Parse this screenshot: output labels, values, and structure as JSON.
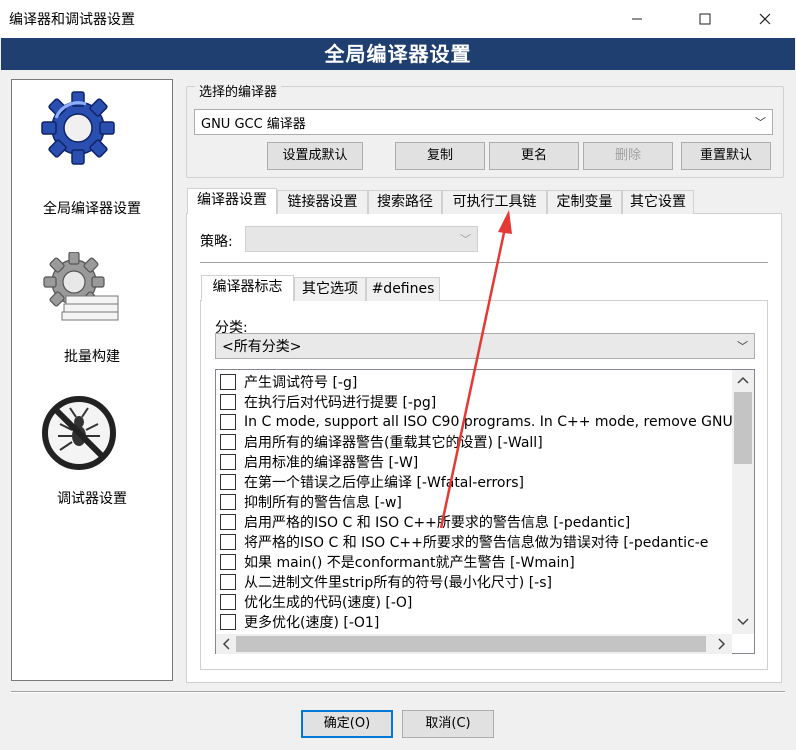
{
  "window": {
    "title": "编译器和调试器设置",
    "minimize": "—",
    "maximize": "☐",
    "close": "✕"
  },
  "banner": {
    "title": "全局编译器设置"
  },
  "sidebar": {
    "items": [
      {
        "label": "全局编译器设置",
        "icon": "gear-icon"
      },
      {
        "label": "批量构建",
        "icon": "batch-build-icon"
      },
      {
        "label": "调试器设置",
        "icon": "no-bug-icon"
      }
    ]
  },
  "compiler_select": {
    "legend": "选择的编译器",
    "selected": "GNU GCC 编译器",
    "buttons": {
      "set_default": "设置成默认",
      "copy": "复制",
      "rename": "更名",
      "delete": "删除",
      "reset_defaults": "重置默认"
    }
  },
  "tabs": [
    "编译器设置",
    "链接器设置",
    "搜索路径",
    "可执行工具链",
    "定制变量",
    "其它设置"
  ],
  "policy": {
    "label": "策略:",
    "value": ""
  },
  "subtabs": [
    "编译器标志",
    "其它选项",
    "#defines"
  ],
  "category": {
    "label": "分类:",
    "selected": "<所有分类>"
  },
  "flags": [
    "产生调试符号  [-g]",
    "在执行后对代码进行提要  [-pg]",
    "In C mode, support all ISO C90 programs. In C++ mode, remove GNU e",
    "启用所有的编译器警告(重载其它的设置)  [-Wall]",
    "启用标准的编译器警告  [-W]",
    "在第一个错误之后停止编译  [-Wfatal-errors]",
    "抑制所有的警告信息  [-w]",
    "启用严格的ISO C 和 ISO C++所要求的警告信息  [-pedantic]",
    "将严格的ISO C 和 ISO C++所要求的警告信息做为错误对待  [-pedantic-e",
    "如果 main() 不是conformant就产生警告  [-Wmain]",
    "从二进制文件里strip所有的符号(最小化尺寸)  [-s]",
    "优化生成的代码(速度)  [-O]",
    "更多优化(速度)  [-O1]"
  ],
  "footer": {
    "ok": "确定(O)",
    "cancel": "取消(C)"
  },
  "colors": {
    "banner": "#1f3f70",
    "annotation_arrow": "#e53935"
  }
}
